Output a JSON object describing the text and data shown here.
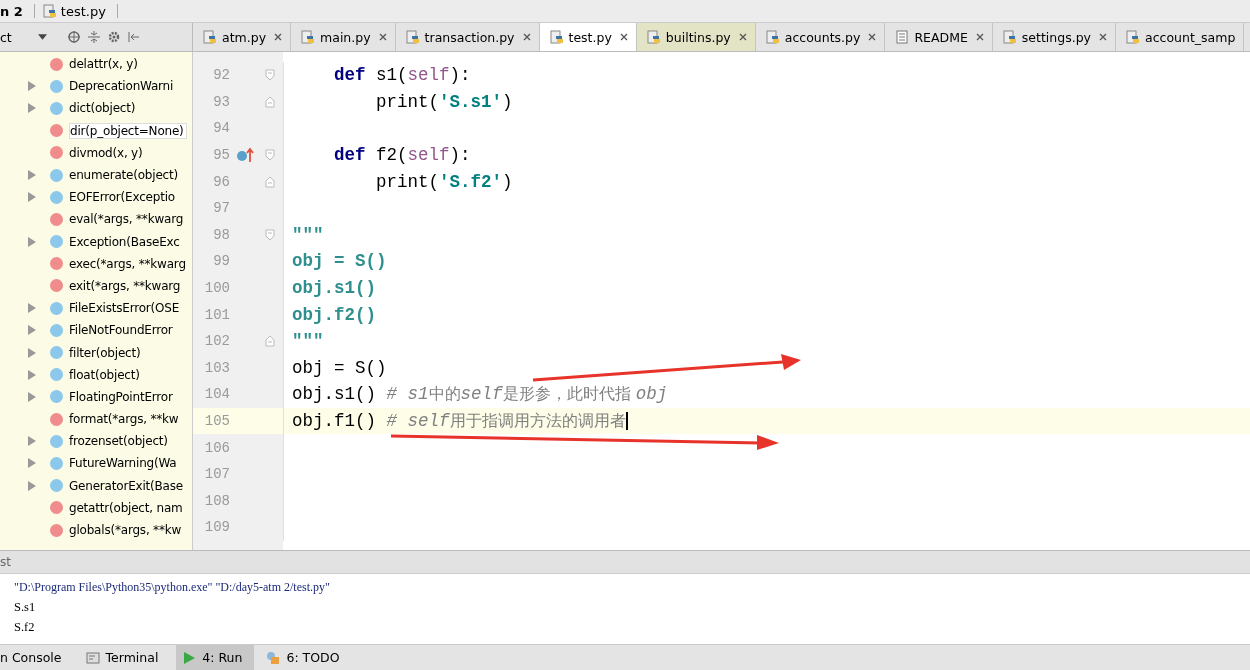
{
  "breadcrumb": [
    {
      "label": "n 2",
      "kind": "folder"
    },
    {
      "label": "test.py",
      "kind": "file"
    }
  ],
  "structure_panel": {
    "title": "ct",
    "items": [
      {
        "label": "delattr(x, y)",
        "kind": "function",
        "expandable": false
      },
      {
        "label": "DeprecationWarni",
        "kind": "class",
        "expandable": true
      },
      {
        "label": "dict(object)",
        "kind": "class",
        "expandable": true
      },
      {
        "label": "dir(p_object=None)",
        "kind": "function",
        "expandable": false
      },
      {
        "label": "divmod(x, y)",
        "kind": "function",
        "expandable": false
      },
      {
        "label": "enumerate(object)",
        "kind": "class",
        "expandable": true
      },
      {
        "label": "EOFError(Exceptio",
        "kind": "class",
        "expandable": true
      },
      {
        "label": "eval(*args, **kwarg",
        "kind": "function",
        "expandable": false
      },
      {
        "label": "Exception(BaseExc",
        "kind": "class",
        "expandable": true
      },
      {
        "label": "exec(*args, **kwarg",
        "kind": "function",
        "expandable": false
      },
      {
        "label": "exit(*args, **kwarg",
        "kind": "function",
        "expandable": false
      },
      {
        "label": "FileExistsError(OSE",
        "kind": "class",
        "expandable": true
      },
      {
        "label": "FileNotFoundError",
        "kind": "class",
        "expandable": true
      },
      {
        "label": "filter(object)",
        "kind": "class",
        "expandable": true
      },
      {
        "label": "float(object)",
        "kind": "class",
        "expandable": true
      },
      {
        "label": "FloatingPointError",
        "kind": "class",
        "expandable": true
      },
      {
        "label": "format(*args, **kw",
        "kind": "function",
        "expandable": false
      },
      {
        "label": "frozenset(object)",
        "kind": "class",
        "expandable": true
      },
      {
        "label": "FutureWarning(Wa",
        "kind": "class",
        "expandable": true
      },
      {
        "label": "GeneratorExit(Base",
        "kind": "class",
        "expandable": true
      },
      {
        "label": "getattr(object, nam",
        "kind": "function",
        "expandable": false
      },
      {
        "label": "globals(*args, **kw",
        "kind": "function",
        "expandable": false
      }
    ]
  },
  "tabs": [
    {
      "label": "atm.py",
      "kind": "python",
      "selected": false,
      "library": false
    },
    {
      "label": "main.py",
      "kind": "python",
      "selected": false,
      "library": false
    },
    {
      "label": "transaction.py",
      "kind": "python",
      "selected": false,
      "library": false
    },
    {
      "label": "test.py",
      "kind": "python",
      "selected": true,
      "library": false
    },
    {
      "label": "builtins.py",
      "kind": "python",
      "selected": false,
      "library": true
    },
    {
      "label": "accounts.py",
      "kind": "python",
      "selected": false,
      "library": false
    },
    {
      "label": "README",
      "kind": "text",
      "selected": false,
      "library": false
    },
    {
      "label": "settings.py",
      "kind": "python",
      "selected": false,
      "library": false
    },
    {
      "label": "account_samp",
      "kind": "python",
      "selected": false,
      "library": false
    }
  ],
  "editor": {
    "lines": [
      {
        "number": "92",
        "fold_start": true,
        "fold_end": false,
        "marker": false,
        "current": false,
        "tokens": [
          {
            "text": "    def ",
            "kind": "keyword"
          },
          {
            "text": "s1(",
            "kind": "plain"
          },
          {
            "text": "self",
            "kind": "self"
          },
          {
            "text": "):",
            "kind": "plain"
          }
        ]
      },
      {
        "number": "93",
        "fold_start": false,
        "fold_end": true,
        "marker": false,
        "current": false,
        "tokens": [
          {
            "text": "        print(",
            "kind": "plain"
          },
          {
            "text": "'S.s1'",
            "kind": "string"
          },
          {
            "text": ")",
            "kind": "plain"
          }
        ]
      },
      {
        "number": "94",
        "fold_start": false,
        "fold_end": false,
        "marker": false,
        "current": false
      },
      {
        "number": "95",
        "fold_start": true,
        "fold_end": false,
        "marker": true,
        "current": false,
        "tokens": [
          {
            "text": "    def ",
            "kind": "keyword"
          },
          {
            "text": "f2(",
            "kind": "plain"
          },
          {
            "text": "self",
            "kind": "self"
          },
          {
            "text": "):",
            "kind": "plain"
          }
        ]
      },
      {
        "number": "96",
        "fold_start": false,
        "fold_end": true,
        "marker": false,
        "current": false,
        "tokens": [
          {
            "text": "        print(",
            "kind": "plain"
          },
          {
            "text": "'S.f2'",
            "kind": "string"
          },
          {
            "text": ")",
            "kind": "plain"
          }
        ]
      },
      {
        "number": "97",
        "fold_start": false,
        "fold_end": false,
        "marker": false,
        "current": false
      },
      {
        "number": "98",
        "fold_start": true,
        "fold_end": false,
        "marker": false,
        "current": false,
        "tokens": [
          {
            "text": "\"\"\"",
            "kind": "docstring"
          }
        ]
      },
      {
        "number": "99",
        "fold_start": false,
        "fold_end": false,
        "marker": false,
        "current": false,
        "tokens": [
          {
            "text": "obj = S()",
            "kind": "docstring"
          }
        ]
      },
      {
        "number": "100",
        "fold_start": false,
        "fold_end": false,
        "marker": false,
        "current": false,
        "tokens": [
          {
            "text": "obj.s1()",
            "kind": "docstring"
          }
        ]
      },
      {
        "number": "101",
        "fold_start": false,
        "fold_end": false,
        "marker": false,
        "current": false,
        "tokens": [
          {
            "text": "obj.f2()",
            "kind": "docstring"
          }
        ]
      },
      {
        "number": "102",
        "fold_start": false,
        "fold_end": true,
        "marker": false,
        "current": false,
        "tokens": [
          {
            "text": "\"\"\"",
            "kind": "docstring"
          }
        ]
      },
      {
        "number": "103",
        "fold_start": false,
        "fold_end": false,
        "marker": false,
        "current": false,
        "tokens": [
          {
            "text": "obj = S()",
            "kind": "plain"
          }
        ]
      },
      {
        "number": "104",
        "fold_start": false,
        "fold_end": false,
        "marker": false,
        "current": false,
        "tokens": [
          {
            "text": "obj.s1() ",
            "kind": "plain"
          },
          {
            "text": "# s1",
            "kind": "comment"
          },
          {
            "text": "中的",
            "kind": "comment-cjk"
          },
          {
            "text": "self",
            "kind": "comment"
          },
          {
            "text": "是形参，此时代指 ",
            "kind": "comment-cjk"
          },
          {
            "text": "obj",
            "kind": "comment"
          }
        ]
      },
      {
        "number": "105",
        "fold_start": false,
        "fold_end": false,
        "marker": false,
        "current": true,
        "tokens": [
          {
            "text": "obj.f1() ",
            "kind": "plain"
          },
          {
            "text": "# self",
            "kind": "comment"
          },
          {
            "text": "用于指调用方法的调用者",
            "kind": "comment-cjk"
          }
        ]
      },
      {
        "number": "106",
        "fold_start": false,
        "fold_end": false,
        "marker": false,
        "current": false
      },
      {
        "number": "107",
        "fold_start": false,
        "fold_end": false,
        "marker": false,
        "current": false
      },
      {
        "number": "108",
        "fold_start": false,
        "fold_end": false,
        "marker": false,
        "current": false
      },
      {
        "number": "109",
        "fold_start": false,
        "fold_end": false,
        "marker": false,
        "current": false
      }
    ]
  },
  "run_panel": {
    "title": "st",
    "output": [
      {
        "text": "\"D:\\Program Files\\Python35\\python.exe\" \"D:/day5-atm 2/test.py\"",
        "kind": "command"
      },
      {
        "text": "S.s1",
        "kind": "stdout"
      },
      {
        "text": "S.f2",
        "kind": "stdout"
      }
    ]
  },
  "tool_windows": [
    {
      "label": "n Console",
      "kind": "console",
      "selected": false
    },
    {
      "label": "Terminal",
      "kind": "terminal",
      "selected": false
    },
    {
      "label": "4: Run",
      "kind": "run",
      "selected": true
    },
    {
      "label": "6: TODO",
      "kind": "todo",
      "selected": false
    }
  ]
}
